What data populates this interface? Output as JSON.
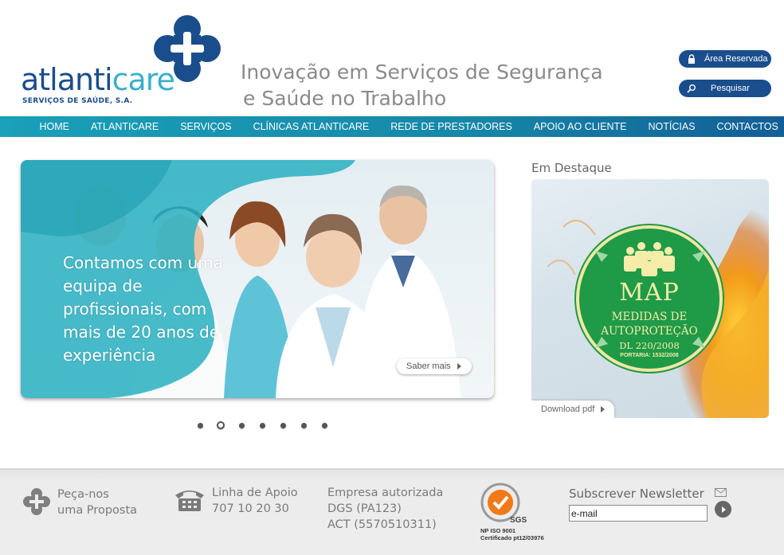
{
  "header": {
    "logo_text_main": "atlanti",
    "logo_text_accent": "care",
    "logo_subtitle": "SERVIÇOS DE SAÚDE, S.A.",
    "tagline_line1": "Inovação em Serviços de Segurança",
    "tagline_line2": "e Saúde no Trabalho",
    "reserved_label": "Área Reservada",
    "search_label": "Pesquisar"
  },
  "nav": {
    "items": [
      {
        "label": "HOME"
      },
      {
        "label": "ATLANTICARE"
      },
      {
        "label": "SERVIÇOS"
      },
      {
        "label": "CLÍNICAS ATLANTICARE"
      },
      {
        "label": "REDE DE PRESTADORES"
      },
      {
        "label": "APOIO AO CLIENTE"
      },
      {
        "label": "NOTÍCIAS"
      },
      {
        "label": "CONTACTOS"
      }
    ]
  },
  "hero": {
    "text": "Contamos com uma equipa de profissionais, com mais de 20 anos de experiência",
    "button_label": "Saber mais",
    "slide_count": 7,
    "active_slide": 2
  },
  "destaque": {
    "title": "Em Destaque",
    "badge_title": "MAP",
    "badge_line1": "MEDIDAS DE",
    "badge_line2": "AUTOPROTEÇÃO",
    "badge_dl": "DL 220/2008",
    "badge_portaria": "PORTARIA: 1532/2008",
    "download_label": "Download pdf"
  },
  "footer": {
    "proposta_line1": "Peça-nos",
    "proposta_line2": "uma Proposta",
    "linha_title": "Linha de Apoio",
    "linha_number": "707 10 20 30",
    "empresa_line1": "Empresa autorizada",
    "empresa_line2": "DGS (PA123)",
    "empresa_line3": "ACT (5570510311)",
    "sgs_label": "SGS",
    "sgs_line1": "NP ISO 9001",
    "sgs_line2": "Certificado pt12/03976",
    "newsletter_title": "Subscrever Newsletter",
    "newsletter_value": "e-mail"
  },
  "colors": {
    "brand_blue": "#1a4d8c",
    "brand_teal": "#3ab0c8",
    "nav_teal": "#1aa0b8",
    "badge_green": "#1f9a47"
  }
}
